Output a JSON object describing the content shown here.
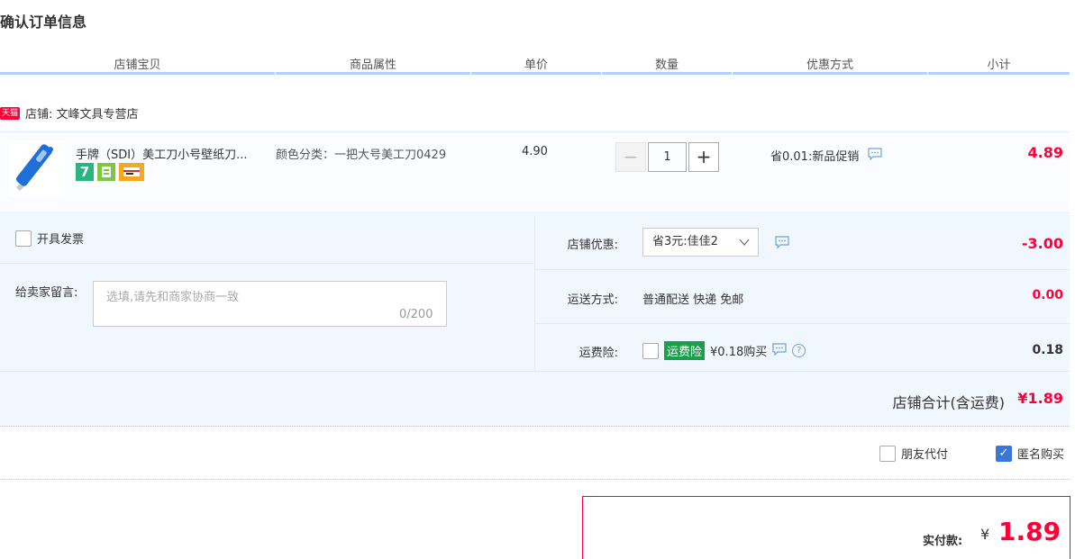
{
  "page_title": "确认订单信息",
  "columns": [
    "店铺宝贝",
    "商品属性",
    "单价",
    "数量",
    "优惠方式",
    "小计"
  ],
  "shop": {
    "badge": "天猫",
    "label": "店铺: 文峰文具专营店"
  },
  "item": {
    "title": "手牌（SDI）美工刀小号壁纸刀...",
    "sku": "颜色分类：一把大号美工刀0429",
    "price": "4.90",
    "quantity": "1",
    "qty_minus": "−",
    "qty_plus": "+",
    "promo": "省0.01:新品促销",
    "icon7": "7",
    "subtotal": "4.89"
  },
  "invoice_label": "开具发票",
  "message": {
    "label": "给卖家留言:",
    "placeholder": "选填,请先和商家协商一致",
    "counter": "0/200"
  },
  "shop_discount": {
    "label": "店铺优惠:",
    "selected": "省3元:佳佳2",
    "amount": "-3.00"
  },
  "shipping": {
    "label": "运送方式:",
    "value": "普通配送 快递 免邮",
    "amount": "0.00"
  },
  "insurance": {
    "label": "运费险:",
    "badge": "运费险",
    "price_text": "¥0.18购买",
    "help": "?",
    "amount": "0.18"
  },
  "shop_total": {
    "label": "店铺合计(含运费)",
    "value": "¥1.89"
  },
  "friend_pay_label": "朋友代付",
  "anonymous_label": "匿名购买",
  "payment": {
    "label": "实付款:",
    "currency": "¥",
    "value": "1.89"
  },
  "colors": {
    "price_red": "#ff0036",
    "header_line": "#b2d1ff",
    "options_bg": "#f1f7ff",
    "checkbox_blue": "#3a77d8",
    "insurance_green": "#1a9f4a"
  }
}
